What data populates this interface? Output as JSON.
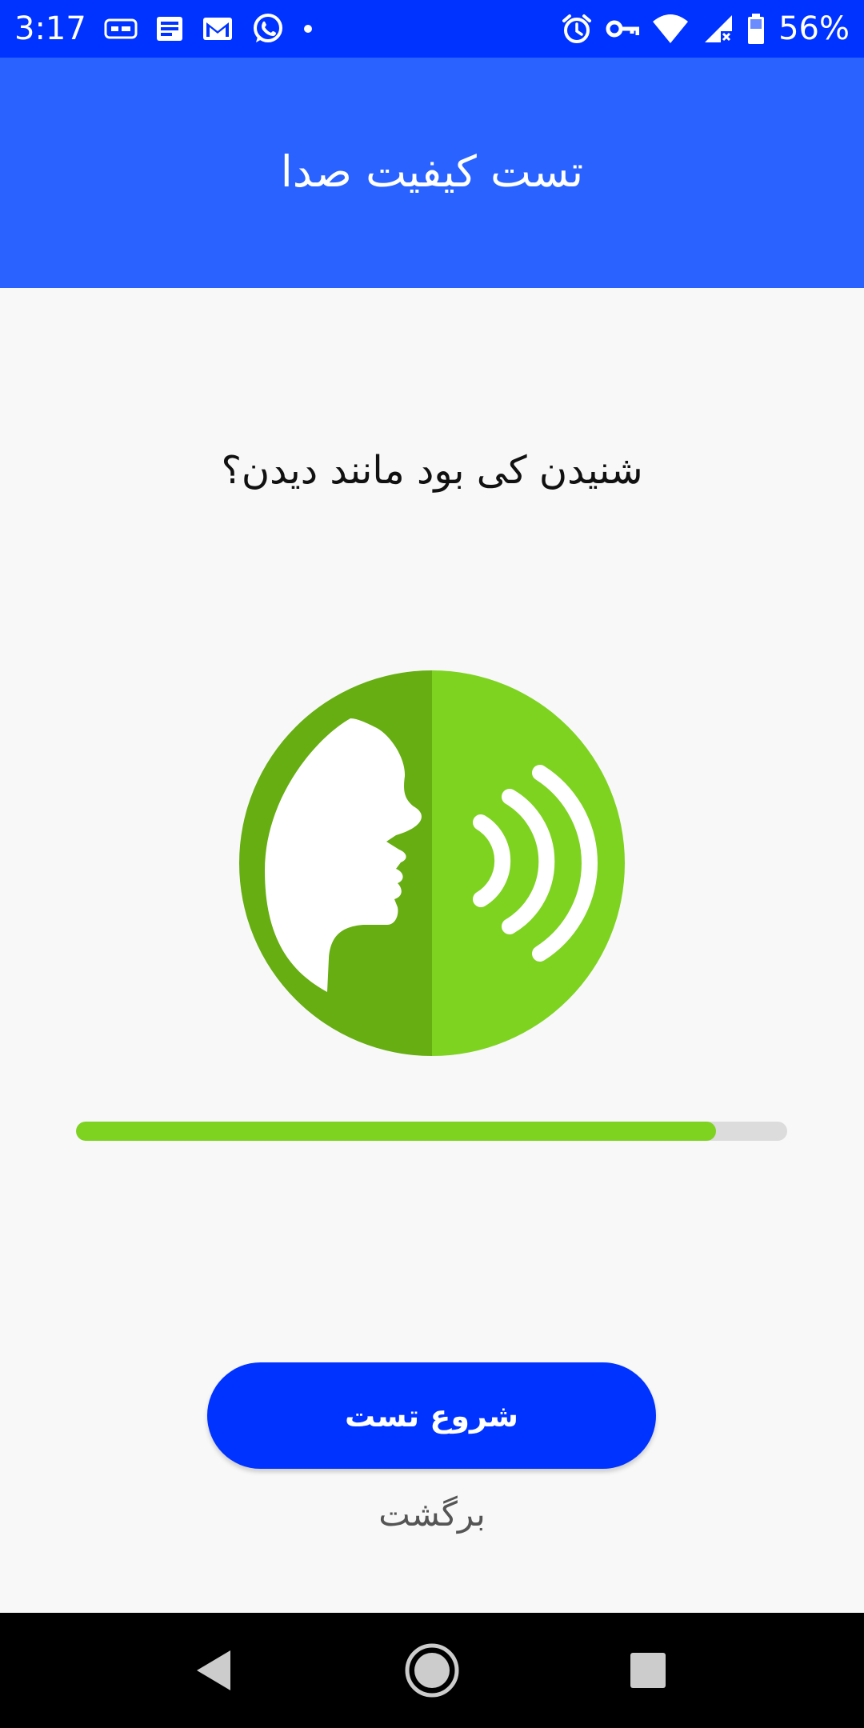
{
  "status_bar": {
    "time": "3:17",
    "battery": "56%",
    "left_icons": [
      "subtitles-icon",
      "news-icon",
      "gmail-icon",
      "whatsapp-icon",
      "dot-icon"
    ],
    "right_icons": [
      "alarm-icon",
      "vpn-key-icon",
      "wifi-icon",
      "cell-signal-icon",
      "battery-icon"
    ]
  },
  "app_bar": {
    "title": "تست کیفیت صدا"
  },
  "main": {
    "question": "شنیدن کی بود مانند دیدن؟",
    "illustration": "speaking-head-icon",
    "progress": 0.9
  },
  "actions": {
    "start_label": "شروع تست",
    "back_label": "برگشت"
  },
  "nav_bar": {
    "buttons": [
      "back-triangle-icon",
      "home-circle-icon",
      "recents-square-icon"
    ]
  },
  "colors": {
    "status_bar": "#0033ff",
    "app_bar": "#2962ff",
    "button": "#0033ff",
    "green_dark": "#66ae12",
    "green_light": "#7ed321",
    "progress_track": "#dcdcdc"
  }
}
